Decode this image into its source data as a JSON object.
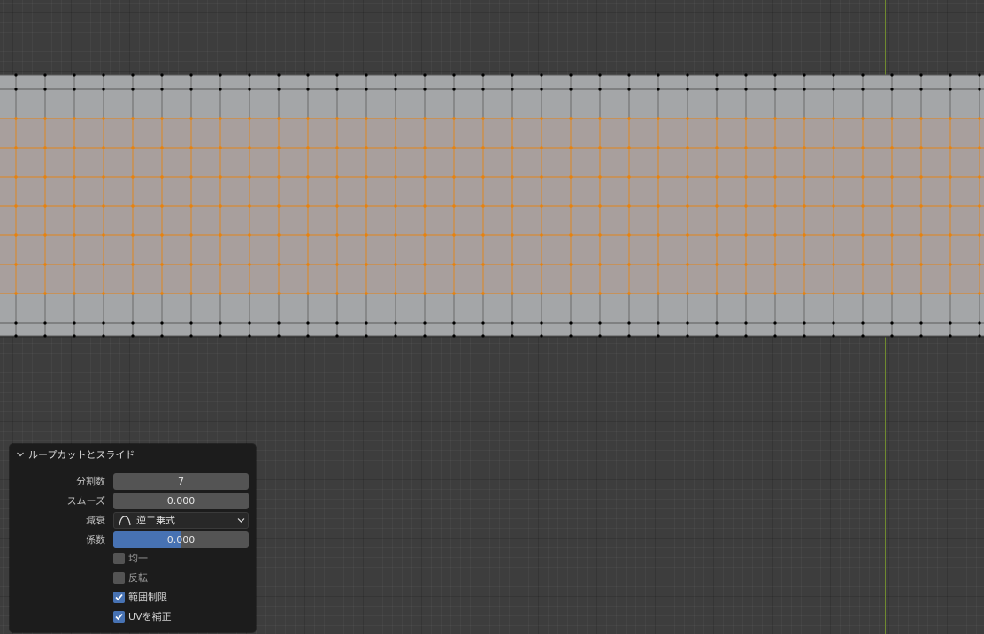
{
  "panel": {
    "title": "ループカットとスライド",
    "cuts": {
      "label": "分割数",
      "value": "7"
    },
    "smoothness": {
      "label": "スムーズ",
      "value": "0.000"
    },
    "falloff": {
      "label": "減衰",
      "value": "逆二乗式"
    },
    "factor": {
      "label": "係数",
      "value": "0.000",
      "fill_fraction": 0.5
    },
    "even": {
      "label": "均一",
      "checked": false
    },
    "flipped": {
      "label": "反転",
      "checked": false
    },
    "clamp": {
      "label": "範囲制限",
      "checked": true
    },
    "correct_uv": {
      "label": "UVを補正",
      "checked": true
    }
  },
  "colors": {
    "background": "#3d3d3d",
    "y_axis": "#6f8a2f",
    "mesh_face": "#a4a6a8",
    "selected_face": "#a89f9d",
    "selected_edge": "#e8820c",
    "vertex": "#000000",
    "accent": "#4772b3",
    "panel": "#1c1c1c"
  }
}
